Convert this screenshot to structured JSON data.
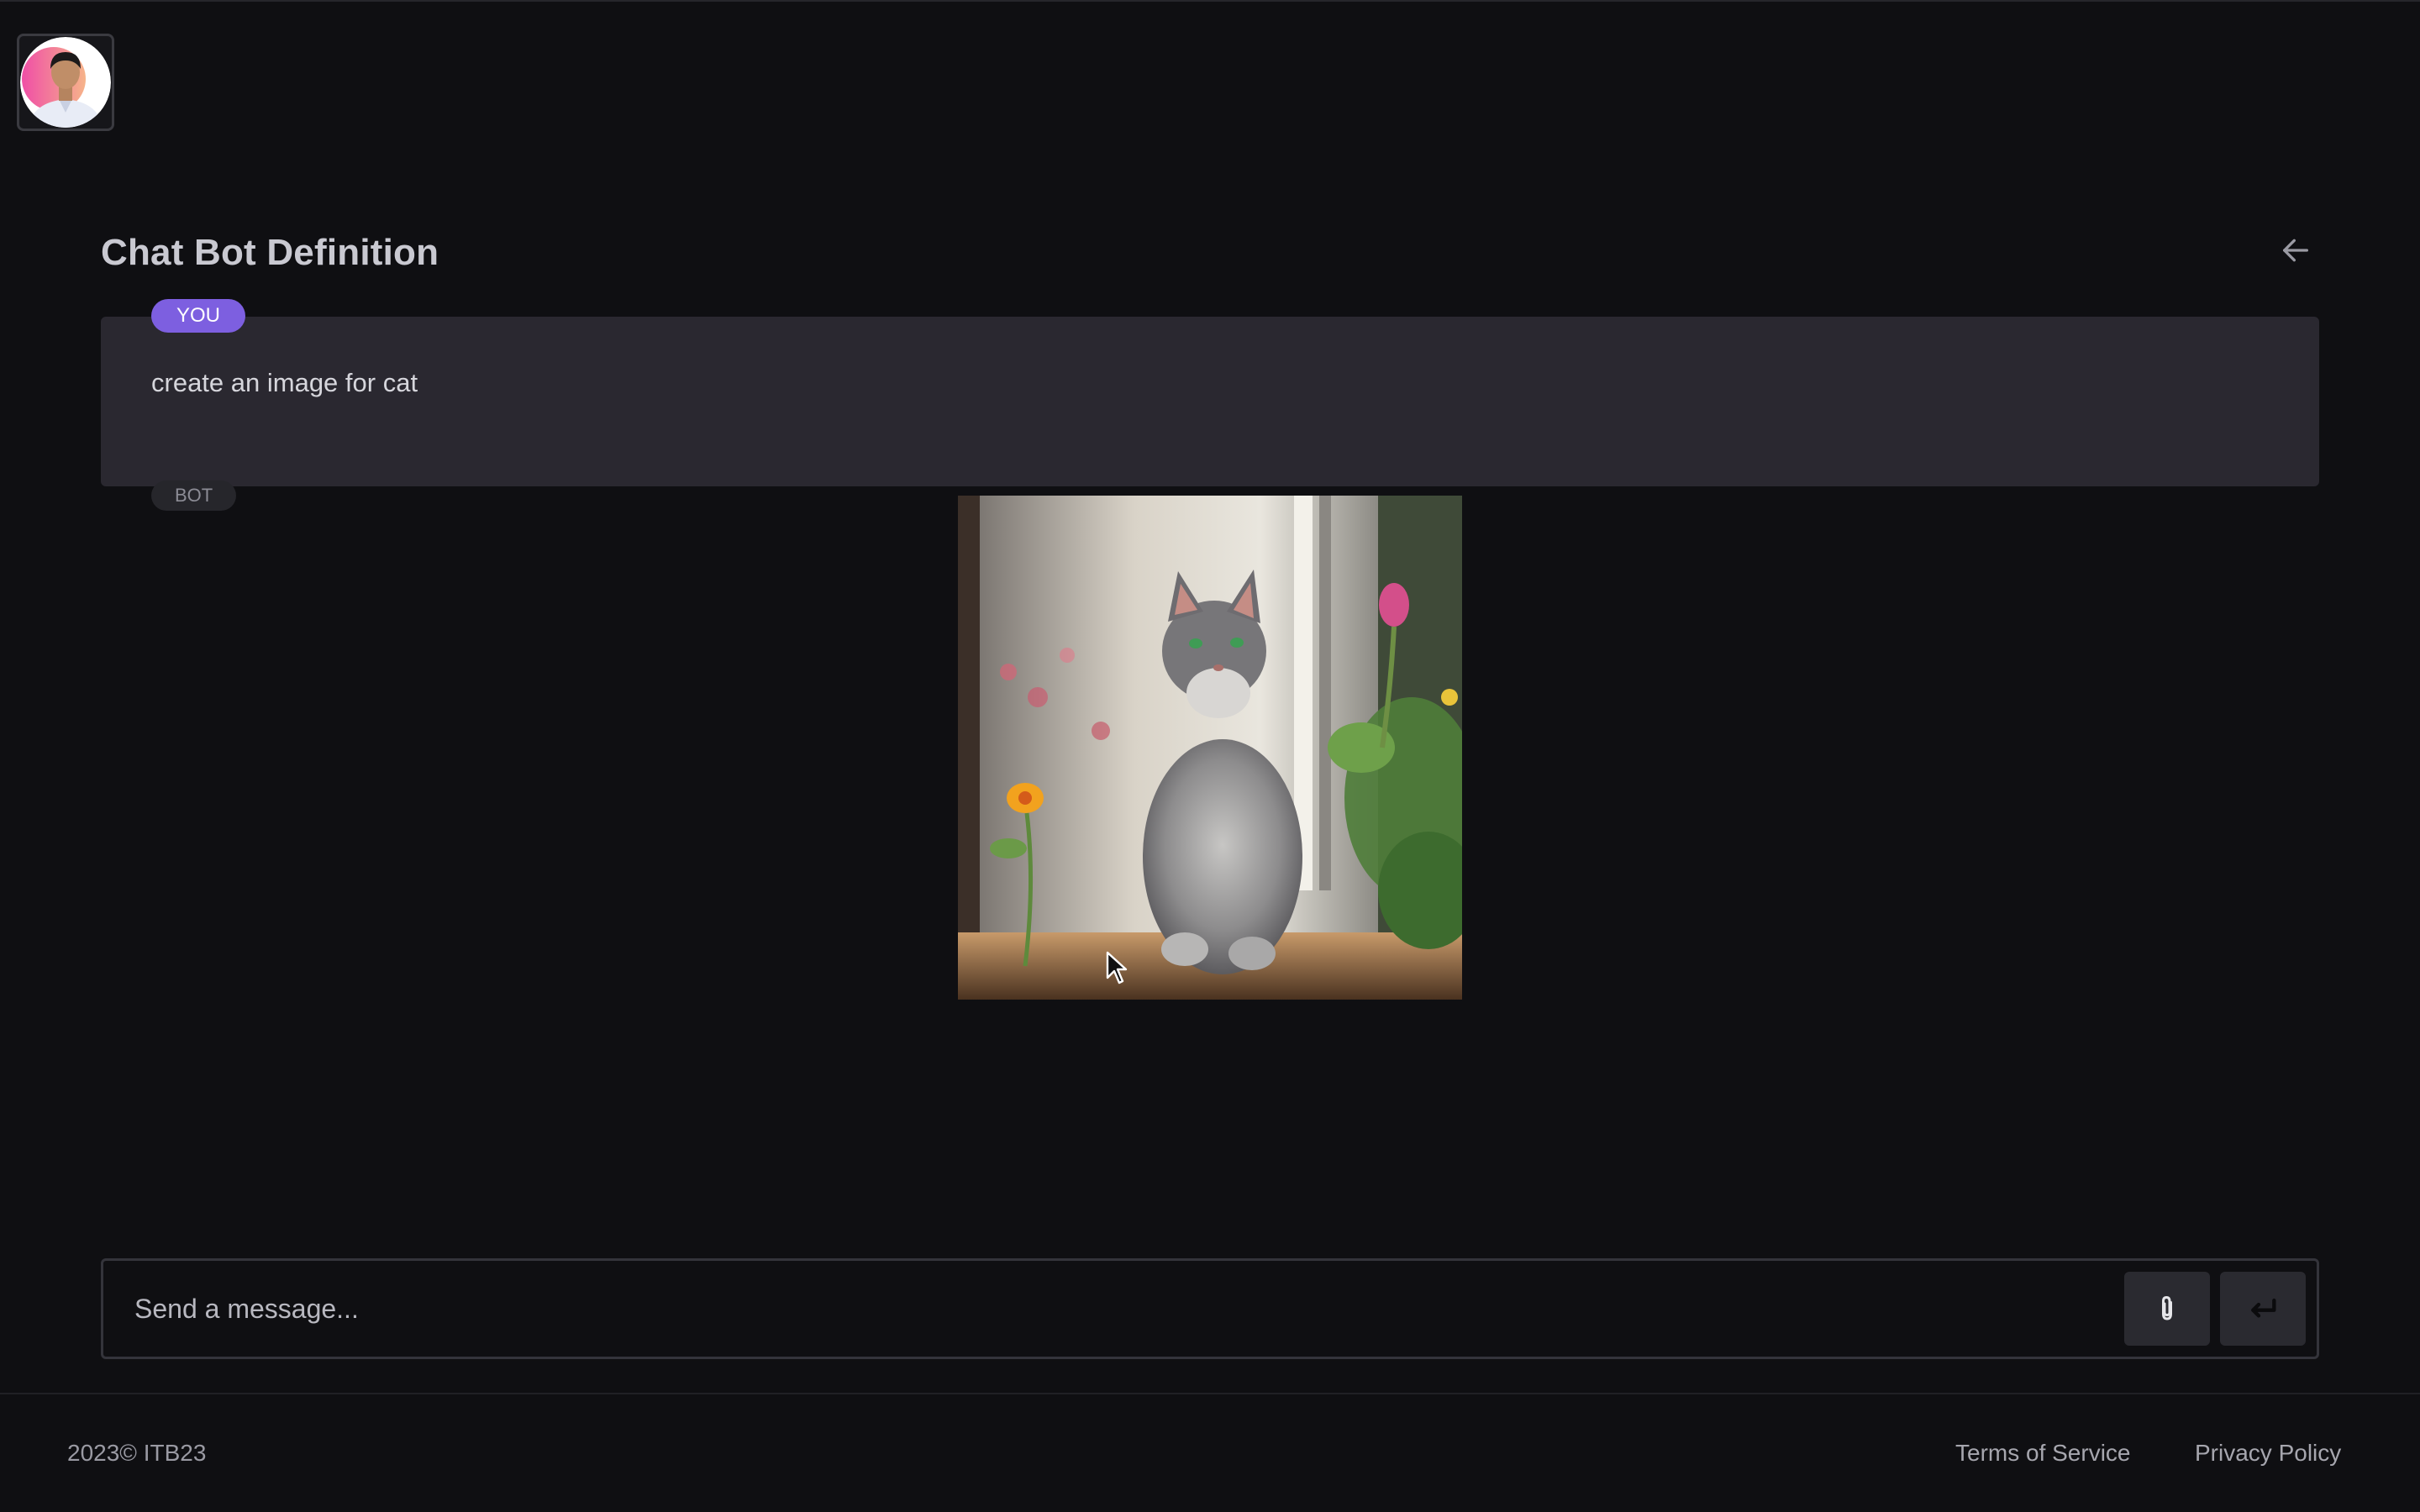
{
  "header": {
    "avatar_icon": "user-avatar"
  },
  "chat": {
    "title": "Chat Bot Definition",
    "back_icon": "arrow-left-icon",
    "messages": [
      {
        "role_label": "YOU",
        "text": "create an image for cat"
      },
      {
        "role_label": "BOT",
        "content": "image",
        "image_subject": "cat-on-windowsill-icon"
      }
    ]
  },
  "composer": {
    "placeholder": "Send a message...",
    "value": "",
    "attach_icon": "paperclip-icon",
    "send_icon": "enter-return-icon"
  },
  "footer": {
    "copyright": "2023© ITB23",
    "links": [
      "Terms of Service",
      "Privacy Policy"
    ]
  },
  "colors": {
    "background": "#0f0f12",
    "user_bubble": "#2a2830",
    "accent": "#7d5fe0",
    "text": "#d6d6dc"
  }
}
